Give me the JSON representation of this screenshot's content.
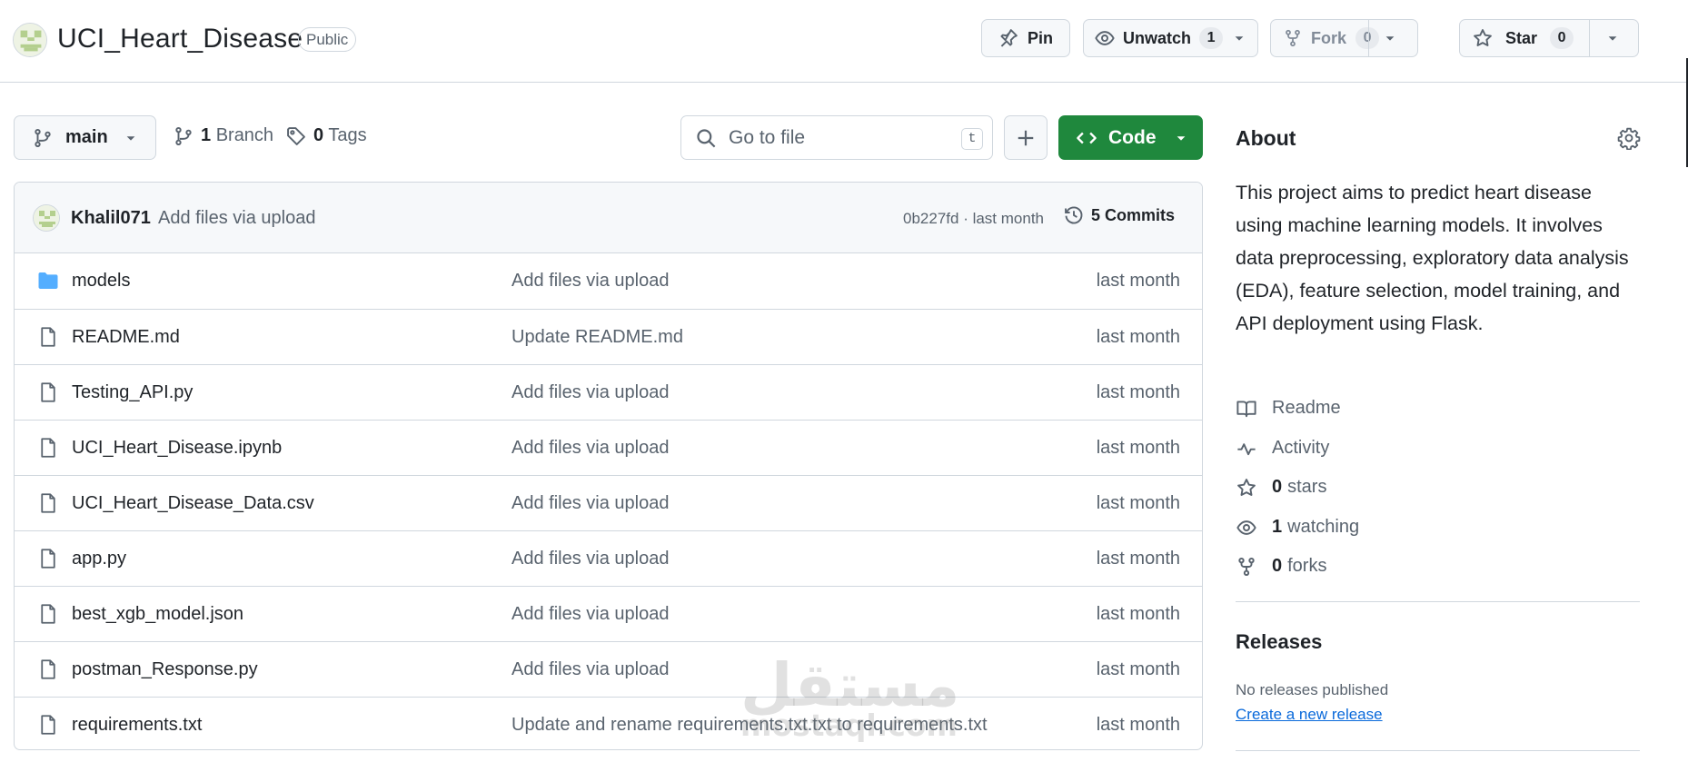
{
  "repo": {
    "name": "UCI_Heart_Disease",
    "visibility": "Public"
  },
  "header_actions": {
    "pin_label": "Pin",
    "unwatch_label": "Unwatch",
    "watch_count": "1",
    "fork_label": "Fork",
    "fork_count": "0",
    "star_label": "Star",
    "star_count": "0"
  },
  "toolbar": {
    "branch": "main",
    "branch_count": "1",
    "branch_label": "Branch",
    "tag_count": "0",
    "tag_label": "Tags",
    "search_placeholder": "Go to file",
    "search_shortcut": "t",
    "code_label": "Code"
  },
  "last_commit": {
    "author": "Khalil071",
    "message": "Add files via upload",
    "hash_time": "0b227fd · last month",
    "commits_label": "5 Commits"
  },
  "files": [
    {
      "name": "models",
      "type": "folder",
      "message": "Add files via upload",
      "date": "last month"
    },
    {
      "name": "README.md",
      "type": "file",
      "message": "Update README.md",
      "date": "last month"
    },
    {
      "name": "Testing_API.py",
      "type": "file",
      "message": "Add files via upload",
      "date": "last month"
    },
    {
      "name": "UCI_Heart_Disease.ipynb",
      "type": "file",
      "message": "Add files via upload",
      "date": "last month"
    },
    {
      "name": "UCI_Heart_Disease_Data.csv",
      "type": "file",
      "message": "Add files via upload",
      "date": "last month"
    },
    {
      "name": "app.py",
      "type": "file",
      "message": "Add files via upload",
      "date": "last month"
    },
    {
      "name": "best_xgb_model.json",
      "type": "file",
      "message": "Add files via upload",
      "date": "last month"
    },
    {
      "name": "postman_Response.py",
      "type": "file",
      "message": "Add files via upload",
      "date": "last month"
    },
    {
      "name": "requirements.txt",
      "type": "file",
      "message": "Update and rename requirements.txt.txt to requirements.txt",
      "date": "last month"
    }
  ],
  "about": {
    "title": "About",
    "description": "This project aims to predict heart disease using machine learning models. It involves data preprocessing, exploratory data analysis (EDA), feature selection, model training, and API deployment using Flask.",
    "readme": "Readme",
    "activity": "Activity",
    "stars_count": "0",
    "stars_label": "stars",
    "watching_count": "1",
    "watching_label": "watching",
    "forks_count": "0",
    "forks_label": "forks"
  },
  "releases": {
    "title": "Releases",
    "none_text": "No releases published",
    "create_link": "Create a new release"
  },
  "watermark": {
    "arabic": "مستقل",
    "latin": "mostaql.com"
  },
  "colors": {
    "accent_green": "#1f883d",
    "link_blue": "#0969da",
    "folder_blue": "#54aeff",
    "muted": "#59636e",
    "border": "#d0d7de"
  }
}
